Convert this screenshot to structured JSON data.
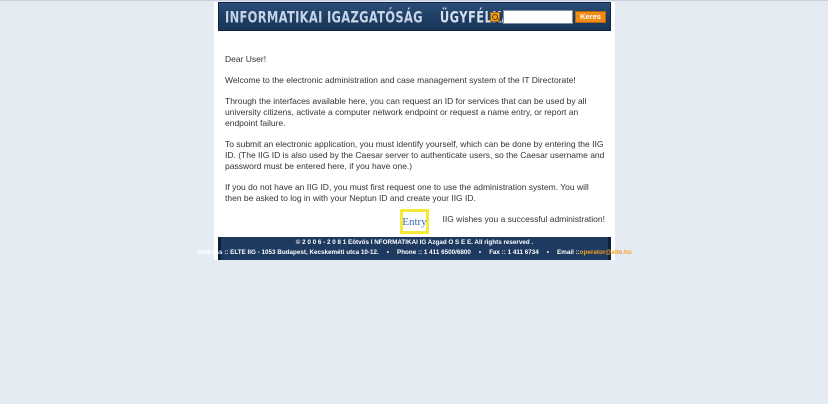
{
  "header": {
    "title_left": "INFORMATIKAI IGAZGATÓSÁG",
    "title_right": "ÜGYFÉLKAPU",
    "search_value": "",
    "search_button": "Keres"
  },
  "content": {
    "greeting": "Dear User!",
    "welcome": "Welcome to the electronic administration and case management system of the IT Directorate!",
    "intro": "Through the interfaces available here, you can request an ID for services that can be used by all university citizens, activate a computer network endpoint or request a name entry, or report an endpoint failure.",
    "identify": "To submit an electronic application, you must identify yourself, which can be done by entering the IIG ID. (The IIG ID is also used by the Caesar server to authenticate users, so the Caesar username and password must be entered here, if you have one.)",
    "no_id": "If you do not have an IIG ID, you must first request one to use the administration system. You will then be asked to log in with your Neptun ID and create your IIG ID.",
    "wishes": "IIG wishes you a successful administration!",
    "entry_label": "Entry"
  },
  "footer": {
    "copyright": "© 2 0 0 6 - 2 0 8 1  Eötvös  I NFORMATIKAI  IG Azgad O S E E. All rights reserved .",
    "address": "Address :: ELTE IIG - 1053 Budapest, Kecskeméti utca 10-12.",
    "phone": "Phone :: 1 411 6500/6800",
    "fax": "Fax :: 1 411 6734",
    "email_label": "Email :: ",
    "email": "operator@elte.hu",
    "separator": "•"
  },
  "colors": {
    "background": "#e5ebf3",
    "header": "#1e3c62",
    "accent": "#f08c14",
    "link": "#3d6ab8",
    "highlight": "#f5e93a"
  }
}
